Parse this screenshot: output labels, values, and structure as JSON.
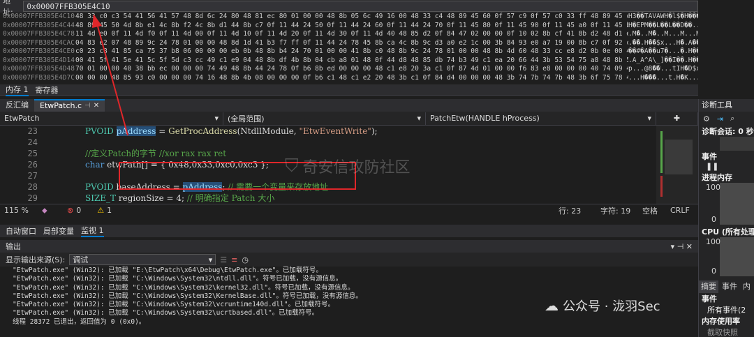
{
  "memory": {
    "address_label": "地址:",
    "address_value": "0x00007FFB305E4C10",
    "rows": [
      {
        "addr": "0x00007FFB305E4C10",
        "hex": "48 33 c0 c3 54 41 56 41 57 48 8d 6c 24 80 48 81 ec 80 01 00 00 48 8b 05 6c 49 16 00 48 33 c4 48 89 45 60 0f 57 c9 0f 57 c0 33 ff 48 89 45 c0 45 8b f8",
        "ascii": "H3��TAVAWH�l$�H���..."
      },
      {
        "addr": "0x00007FFB305E4C44",
        "hex": "48 89 45 50 4d 8b e1 4c 8b f2 4c 8b d1 44 8b c7 0f 11 44 24 50 0f 11 44 24 60 0f 11 44 24 70 0f 11 45 80 0f 11 45 90 0f 11 45 a0 0f 11 45 b0 0f 11 4d d0 0f",
        "ascii": "H�EPM��L��L��D��..D$P"
      },
      {
        "addr": "0x00007FFB305E4C78",
        "hex": "11 4d e0 0f 11 4d f0 0f 11 4d 00 0f 11 4d 10 0f 11 4d 20 0f 11 4d 30 0f 11 4d 40 48 85 d2 0f 84 47 02 00 00 0f 10 02 8b cf 41 8b d2 48 d1 ea 41 8b c2 c1 e8",
        "ascii": ".M�..M�..M...M...M...M0"
      },
      {
        "addr": "0x00007FFB305E4CAC",
        "hex": "04 83 e2 07 48 89 9c 24 78 01 00 00 48 8d 1d 41 b3 f7 ff 0f 11 44 24 78 45 8b ca 4c 8b 9c d3 a0 e2 1c 00 3b 84 93 e0 a7 19 00 8b c7 0f 92 c1 4d 85 db 0f 95",
        "ascii": ".��.H��$x...H�.A����.."
      },
      {
        "addr": "0x00007FFB305E4CE0",
        "hex": "c0 23 c8 41 85 ca 75 37 b8 06 00 00 00 eb 0b 48 8b b4 24 70 01 00 00 41 8b c0 48 8b 9c 24 78 01 00 00 48 8b 4d 60 48 33 cc e8 d2 0b 0e 00 48 81 c4 80 01 00",
        "ascii": "��#�A��u7�...�.H��$p.."
      },
      {
        "addr": "0x00007FFB305E4D14",
        "hex": "00 41 5f 41 5e 41 5c 5f 5d c3 cc 49 c1 e9 04 48 8b df 4b 8b 04 cb a8 01 48 0f 44 d8 48 85 db 74 b3 49 c1 ea 20 66 44 3b 53 54 75 a8 48 8b 55 80 48 89 b4 24",
        "ascii": ".A_A^A\\_]��I��.H��K��.."
      },
      {
        "addr": "0x00007FFB305E4D48",
        "hex": "70 01 00 00 40 38 bb ec 00 00 00 74 49 48 8b 44 24 78 0f b6 8b ed 00 00 00 48 c1 e8 20 3a c1 0f 87 4d 01 00 00 f6 83 e8 00 00 00 40 74 09 48 85 d2 0f 84 f4",
        "ascii": "p...@8��...tIH�D$x.���"
      },
      {
        "addr": "0x00007FFB305E4D7C",
        "hex": "00 00 00 48 85 93 c0 00 00 00 74 16 48 8b 4b 08 00 00 00 0f b6 c1 48 c1 e2 20 48 3b c1 0f 84 d4 00 00 00 48 3b 74 7b 74 7b 48 3b 6f 75 78 48 8b 85 a0 00",
        "ascii": "...H���...t.H�K..."
      }
    ]
  },
  "memory_tabs": [
    "内存 1",
    "寄存器"
  ],
  "editor": {
    "tabs": [
      {
        "label": "反汇编"
      },
      {
        "label": "EtwPatch.c"
      }
    ],
    "pin": "⊣",
    "close": "✕",
    "nav_project": "EtwPatch",
    "nav_scope": "(全局范围)",
    "nav_function": "PatchEtw(HANDLE hProcess)",
    "line_numbers": [
      "23",
      "24",
      "25",
      "26",
      "27",
      "28",
      "29"
    ],
    "line23": {
      "type": "PVOID",
      "var": "pAddress",
      "eq": " = ",
      "fn": "GetProcAddress",
      "args_open": "(NtdllModule, ",
      "str": "\"EtwEventWrite\"",
      "end": ");"
    },
    "line25": "//定义Patch的字节 //xor rax rax ret",
    "line26": {
      "kw": "char",
      "rest": " etwPath[] = { 0x48,0x33,0xc0,0xc3 };"
    },
    "line28": {
      "type": "PVOID",
      "var": " baseAddress = ",
      "sel": "pAddress",
      "end": "; ",
      "cm": "// 需要一个变量来存放地址"
    },
    "line29": {
      "type": "SIZE_T",
      "var": " regionSize = 4; ",
      "cm": "// 明确指定 Patch 大小"
    },
    "status": {
      "zoom": "115 %",
      "errors": "0",
      "warnings": "1",
      "line": "行: 23",
      "col": "字符: 19",
      "space": "空格",
      "eol": "CRLF"
    }
  },
  "watch_tabs": [
    "自动窗口",
    "局部变量",
    "监视 1"
  ],
  "output": {
    "title": "输出",
    "source_label": "显示输出来源(S):",
    "source_value": "调试",
    "lines": [
      "\"EtwPatch.exe\" (Win32): 已加载 \"E:\\EtwPatch\\x64\\Debug\\EtwPatch.exe\"。已加载符号。",
      "\"EtwPatch.exe\" (Win32): 已加载 \"C:\\Windows\\System32\\ntdll.dll\"。符号已加载，没有源信息。",
      "\"EtwPatch.exe\" (Win32): 已加载 \"C:\\Windows\\System32\\kernel32.dll\"。符号已加载，没有源信息。",
      "\"EtwPatch.exe\" (Win32): 已加载 \"C:\\Windows\\System32\\KernelBase.dll\"。符号已加载，没有源信息。",
      "\"EtwPatch.exe\" (Win32): 已加载 \"C:\\Windows\\System32\\vcruntime140d.dll\"。已加载符号。",
      "\"EtwPatch.exe\" (Win32): 已加载 \"C:\\Windows\\System32\\ucrtbased.dll\"。已加载符号。",
      "线程 28372 已退出，返回值为 0 (0x0)。"
    ]
  },
  "diag": {
    "title": "诊断工具",
    "session": "诊断会话: 0 秒 (",
    "events": "事件",
    "memory": "进程内存",
    "mem_max": "100",
    "mem_min": "0",
    "cpu": "CPU (所有处理",
    "cpu_max": "100",
    "cpu_min": "0",
    "tabs": [
      "摘要",
      "事件",
      "内"
    ],
    "ev_label": "事件",
    "ev_item": "所有事件(2",
    "mem_usage": "内存使用率",
    "snapshot": "截取快照"
  },
  "watermarks": {
    "center": "奇安信攻防社区",
    "corner": "公众号 · 泷羽Sec"
  }
}
